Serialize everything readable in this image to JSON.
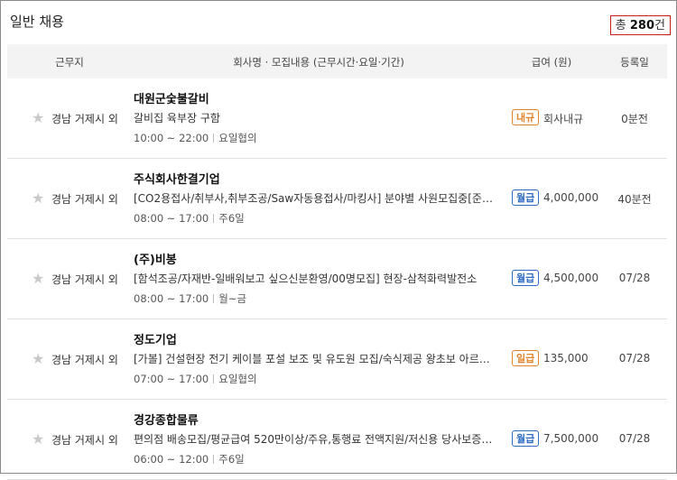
{
  "header": {
    "title": "일반 채용",
    "total_prefix": "총",
    "total_count": "280",
    "total_suffix": "건"
  },
  "columns": {
    "location": "근무지",
    "company": "회사명 · 모집내용 (근무시간·요일·기간)",
    "salary": "급여 (원)",
    "date": "등록일"
  },
  "rows": [
    {
      "location": "경남 거제시 외",
      "company": "대원군숯불갈비",
      "desc": "갈비집 육부장 구함",
      "time": "10:00 ~ 22:00",
      "days": "요일협의",
      "pay_type": "내규",
      "pay_type_color": "orange",
      "amount": "회사내규",
      "date": "0분전"
    },
    {
      "location": "경남 거제시 외",
      "company": "주식회사한결기업",
      "desc": "[CO2용접사/취부사,취부조공/Saw자동용접사/마킹사] 분야별 사원모집중[준기량...",
      "time": "08:00 ~ 17:00",
      "days": "주6일",
      "pay_type": "월급",
      "pay_type_color": "blue",
      "amount": "4,000,000",
      "date": "40분전"
    },
    {
      "location": "경남 거제시 외",
      "company": "(주)비봉",
      "desc": "[함석조공/자재반-일배워보고 싶으신분환영/00명모집] 현장-삼척화력발전소",
      "time": "08:00 ~ 17:00",
      "days": "월~금",
      "pay_type": "월급",
      "pay_type_color": "blue",
      "amount": "4,500,000",
      "date": "07/28"
    },
    {
      "location": "경남 거제시 외",
      "company": "정도기업",
      "desc": "[가볼] 건설현장 전기 케이블 포설 보조 및 유도원 모집/숙식제공 왕초보 아르바...",
      "time": "07:00 ~ 17:00",
      "days": "요일협의",
      "pay_type": "일급",
      "pay_type_color": "orange",
      "amount": "135,000",
      "date": "07/28"
    },
    {
      "location": "경남 거제시 외",
      "company": "경강종합물류",
      "desc": "편의점 배송모집/평균급여 520만이상/주유,통행료 전액지원/저신용 당사보증 ...",
      "time": "06:00 ~ 12:00",
      "days": "주6일",
      "pay_type": "월급",
      "pay_type_color": "blue",
      "amount": "7,500,000",
      "date": "07/28"
    }
  ],
  "icons": {
    "favorite": "star-icon"
  },
  "colors": {
    "blue_badge": "#2d6bc4",
    "orange_badge": "#e3832a",
    "total_border": "#d11b1b"
  }
}
